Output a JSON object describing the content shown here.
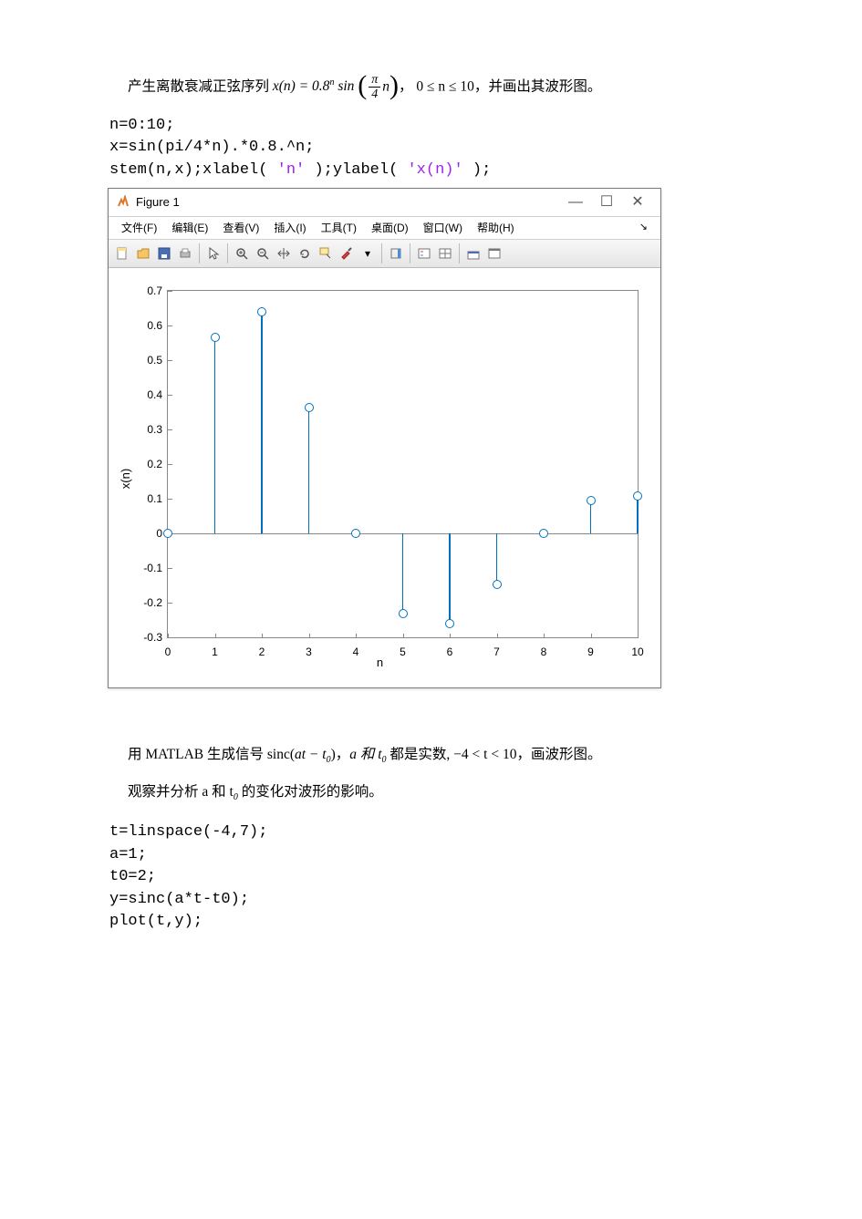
{
  "problem1": {
    "prefix": "产生离散衰减正弦序列 ",
    "formula_lhs": "x(n) = 0.8",
    "formula_exp": "n",
    "formula_sin": " sin",
    "frac_num": "π",
    "frac_den": "4",
    "frac_post": "n",
    "range": "，  0 ≤ n ≤ 10，并画出其波形图。"
  },
  "code1": {
    "l1": "n=0:10;",
    "l2": "x=sin(pi/4*n).*0.8.^n;",
    "l3a": "stem(n,x);xlabel( ",
    "l3s1": "'n'",
    "l3b": " );ylabel( ",
    "l3s2": "'x(n)'",
    "l3c": " );"
  },
  "figure": {
    "title": "Figure 1",
    "menus": [
      "文件(F)",
      "编辑(E)",
      "查看(V)",
      "插入(I)",
      "工具(T)",
      "桌面(D)",
      "窗口(W)",
      "帮助(H)"
    ],
    "xlabel": "n",
    "ylabel": "x(n)"
  },
  "chart_data": {
    "type": "stem",
    "title": "",
    "xlabel": "n",
    "ylabel": "x(n)",
    "xticks": [
      0,
      1,
      2,
      3,
      4,
      5,
      6,
      7,
      8,
      9,
      10
    ],
    "yticks": [
      -0.3,
      -0.2,
      -0.1,
      0,
      0.1,
      0.2,
      0.3,
      0.4,
      0.5,
      0.6,
      0.7
    ],
    "xlim": [
      0,
      10
    ],
    "ylim": [
      -0.3,
      0.7
    ],
    "x": [
      0,
      1,
      2,
      3,
      4,
      5,
      6,
      7,
      8,
      9,
      10
    ],
    "y": [
      0.0,
      0.5657,
      0.64,
      0.362,
      0.0,
      -0.2318,
      -0.2621,
      -0.1483,
      0.0,
      0.0949,
      0.1074
    ]
  },
  "problem2": {
    "line1_a": "用 MATLAB 生成信号 sinc(",
    "line1_b": "at − t",
    "line1_c": ")，",
    "line1_d": "a 和 t",
    "line1_e": " 都是实数, −4 < t < 10，画波形图。",
    "line2_a": "观察并分析 a 和 t",
    "line2_b": " 的变化对波形的影响。"
  },
  "code2": {
    "l1": "t=linspace(-4,7);",
    "l2": "a=1;",
    "l3": "t0=2;",
    "l4": "y=sinc(a*t-t0);",
    "l5": "plot(t,y);"
  }
}
